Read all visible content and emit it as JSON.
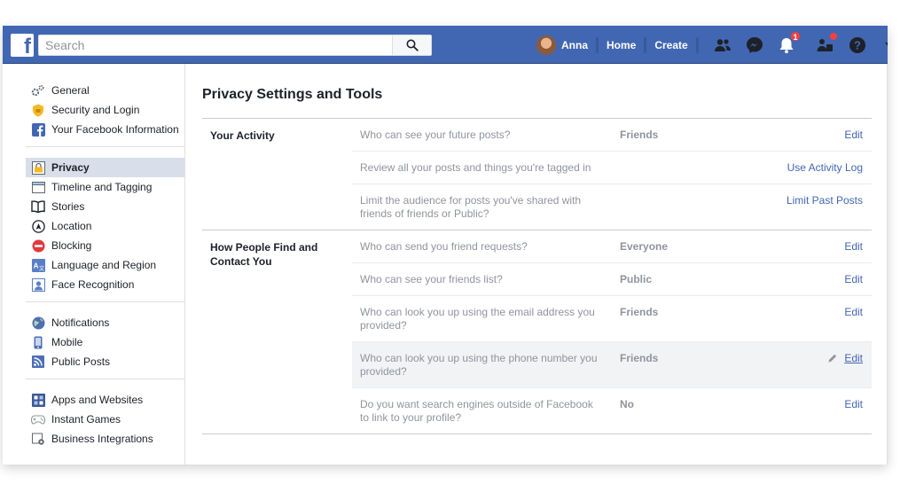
{
  "topbar": {
    "logo": "f",
    "search_placeholder": "Search",
    "user_name": "Anna",
    "home": "Home",
    "create": "Create",
    "notification_count": "1"
  },
  "sidebar": {
    "groups": [
      [
        {
          "label": "General",
          "icon": "gear-icon"
        },
        {
          "label": "Security and Login",
          "icon": "badge-icon"
        },
        {
          "label": "Your Facebook Information",
          "icon": "facebook-icon"
        }
      ],
      [
        {
          "label": "Privacy",
          "icon": "lock-icon",
          "active": true
        },
        {
          "label": "Timeline and Tagging",
          "icon": "timeline-icon"
        },
        {
          "label": "Stories",
          "icon": "book-icon"
        },
        {
          "label": "Location",
          "icon": "location-icon"
        },
        {
          "label": "Blocking",
          "icon": "block-icon"
        },
        {
          "label": "Language and Region",
          "icon": "language-icon"
        },
        {
          "label": "Face Recognition",
          "icon": "face-icon"
        }
      ],
      [
        {
          "label": "Notifications",
          "icon": "globe-icon"
        },
        {
          "label": "Mobile",
          "icon": "mobile-icon"
        },
        {
          "label": "Public Posts",
          "icon": "rss-icon"
        }
      ],
      [
        {
          "label": "Apps and Websites",
          "icon": "apps-icon"
        },
        {
          "label": "Instant Games",
          "icon": "gamepad-icon"
        },
        {
          "label": "Business Integrations",
          "icon": "business-icon"
        }
      ]
    ]
  },
  "main": {
    "title": "Privacy Settings and Tools",
    "sections": [
      {
        "label": "Your Activity",
        "rows": [
          {
            "question": "Who can see your future posts?",
            "value": "Friends",
            "action": "Edit"
          },
          {
            "question": "Review all your posts and things you're tagged in",
            "value": "",
            "action": "Use Activity Log"
          },
          {
            "question": "Limit the audience for posts you've shared with friends of friends or Public?",
            "value": "",
            "action": "Limit Past Posts"
          }
        ]
      },
      {
        "label": "How People Find and Contact You",
        "rows": [
          {
            "question": "Who can send you friend requests?",
            "value": "Everyone",
            "action": "Edit"
          },
          {
            "question": "Who can see your friends list?",
            "value": "Public",
            "action": "Edit"
          },
          {
            "question": "Who can look you up using the email address you provided?",
            "value": "Friends",
            "action": "Edit"
          },
          {
            "question": "Who can look you up using the phone number you provided?",
            "value": "Friends",
            "action": "Edit",
            "hover": true
          },
          {
            "question": "Do you want search engines outside of Facebook to link to your profile?",
            "value": "No",
            "action": "Edit"
          }
        ]
      }
    ]
  },
  "colors": {
    "brand": "#4267b2",
    "active_bg": "#d8dfea",
    "badge": "#fa3e3e"
  }
}
